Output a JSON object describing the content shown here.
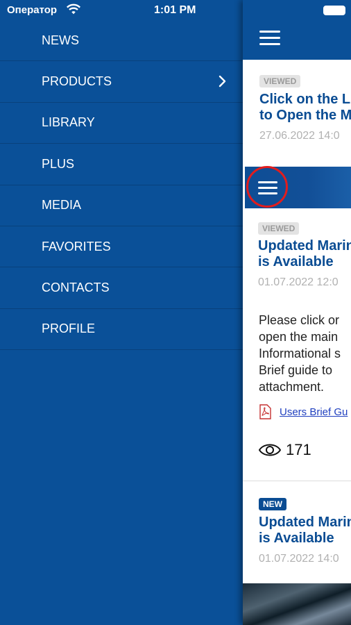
{
  "status_bar": {
    "carrier": "Оператор",
    "time": "1:01 PM"
  },
  "menu": {
    "items": [
      {
        "label": "NEWS"
      },
      {
        "label": "PRODUCTS",
        "has_submenu": true
      },
      {
        "label": "LIBRARY"
      },
      {
        "label": "PLUS"
      },
      {
        "label": "MEDIA"
      },
      {
        "label": "FAVORITES"
      },
      {
        "label": "CONTACTS"
      },
      {
        "label": "PROFILE"
      }
    ]
  },
  "feed": {
    "cards": [
      {
        "badge": "VIEWED",
        "title_line1": "Click on the Li",
        "title_line2": "to Open the M",
        "date": "27.06.2022 14:0"
      },
      {
        "badge": "VIEWED",
        "title_line1": "Updated Marin",
        "title_line2": "is Available",
        "date": "01.07.2022 12:0",
        "body": [
          "Please click or",
          "open the main",
          "Informational s",
          "Brief guide to",
          "attachment."
        ],
        "attachment": "Users Brief Gu",
        "views": "171"
      },
      {
        "badge": "NEW",
        "title_line1": "Updated Marin",
        "title_line2": "is Available",
        "date": "01.07.2022 14:0"
      }
    ]
  },
  "colors": {
    "menu_bg": "#0a5098",
    "title_blue": "#0a4c93",
    "highlight_ring": "#e21d1d",
    "link": "#1f3fbf"
  },
  "icons": [
    "wifi-icon",
    "battery-icon",
    "chevron-right-icon",
    "hamburger-menu-icon",
    "pdf-icon",
    "eye-icon"
  ]
}
